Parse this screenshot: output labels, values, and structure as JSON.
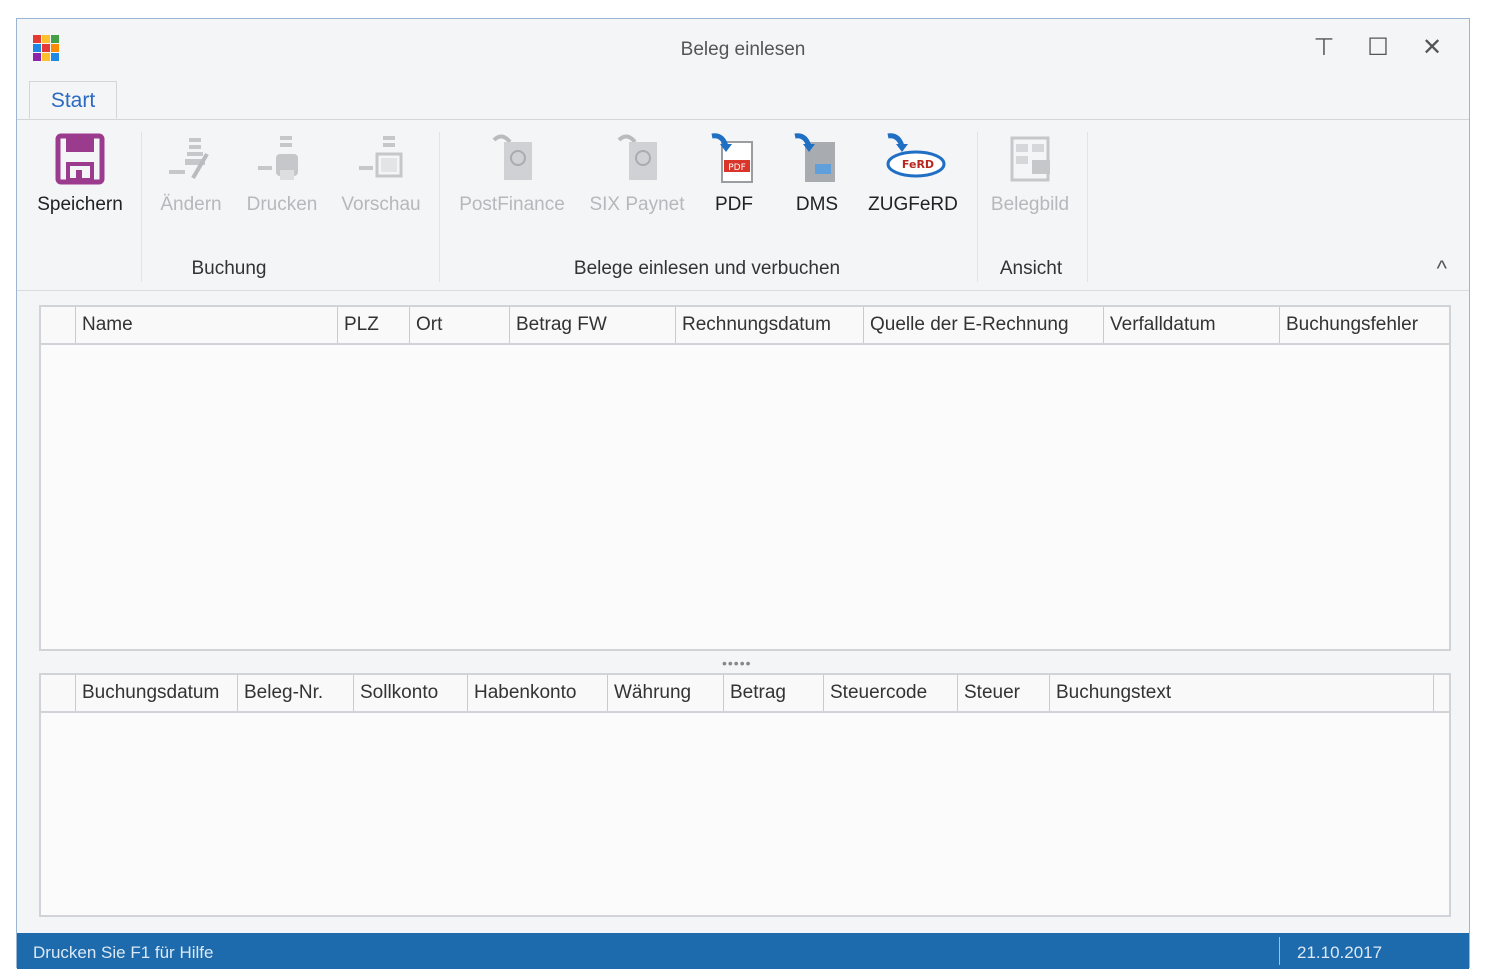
{
  "window": {
    "title": "Beleg einlesen",
    "controls": {
      "restore": "⊤",
      "maximize": "☐",
      "close": "✕"
    }
  },
  "tabs": [
    {
      "label": "Start",
      "active": true
    }
  ],
  "ribbon": {
    "groups": {
      "buchung": "Buchung",
      "belege": "Belege einlesen und verbuchen",
      "ansicht": "Ansicht"
    },
    "buttons": {
      "speichern": {
        "label": "Speichern",
        "icon": "floppy-disk-icon",
        "enabled": true
      },
      "aendern": {
        "label": "Ändern",
        "icon": "edit-icon",
        "enabled": false
      },
      "drucken": {
        "label": "Drucken",
        "icon": "printer-icon",
        "enabled": false
      },
      "vorschau": {
        "label": "Vorschau",
        "icon": "preview-icon",
        "enabled": false
      },
      "postfinance": {
        "label": "PostFinance",
        "icon": "import-document-icon",
        "enabled": false
      },
      "six_paynet": {
        "label": "SIX Paynet",
        "icon": "import-document-icon",
        "enabled": false
      },
      "pdf": {
        "label": "PDF",
        "icon": "pdf-import-icon",
        "enabled": true
      },
      "dms": {
        "label": "DMS",
        "icon": "dms-import-icon",
        "enabled": true
      },
      "zugferd": {
        "label": "ZUGFeRD",
        "icon": "zugferd-import-icon",
        "enabled": true
      },
      "belegbild": {
        "label": "Belegbild",
        "icon": "document-view-icon",
        "enabled": false
      }
    },
    "collapse_glyph": "^"
  },
  "top_grid": {
    "columns": [
      "Name",
      "PLZ",
      "Ort",
      "Betrag FW",
      "Rechnungsdatum",
      "Quelle der E-Rechnung",
      "Verfalldatum",
      "Buchungsfehler"
    ],
    "rows": []
  },
  "splitter_glyph": "•••••",
  "bottom_grid": {
    "columns": [
      "Buchungsdatum",
      "Beleg-Nr.",
      "Sollkonto",
      "Habenkonto",
      "Währung",
      "Betrag",
      "Steuercode",
      "Steuer",
      "Buchungstext"
    ],
    "rows": []
  },
  "status": {
    "help_text": "Drucken Sie F1 für Hilfe",
    "date": "21.10.2017"
  },
  "colors": {
    "accent": "#1d6bad",
    "tab_text": "#2c6ac1",
    "save_icon": "#9b3b8e",
    "import_arrow": "#1f6fc4",
    "pdf_red": "#d9352a"
  }
}
